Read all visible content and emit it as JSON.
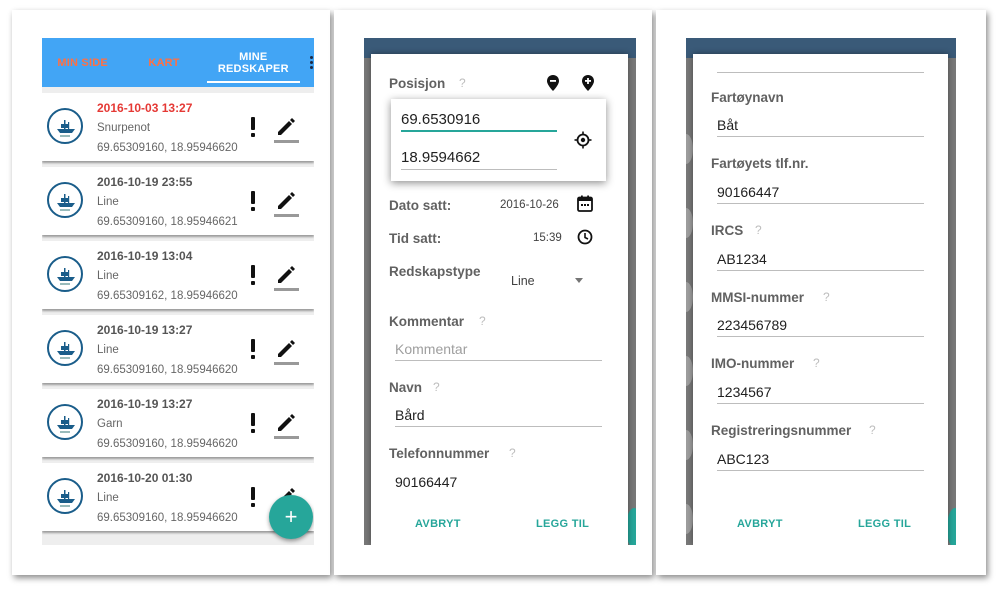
{
  "screen1": {
    "tabs": [
      {
        "label": "MIN SIDE"
      },
      {
        "label": "KART"
      },
      {
        "label": "MINE REDSKAPER"
      }
    ],
    "items": [
      {
        "date": "2016-10-03 13:27",
        "type": "Snurpenot",
        "position": "69.65309160, 18.95946620"
      },
      {
        "date": "2016-10-19 23:55",
        "type": "Line",
        "position": "69.65309160, 18.95946621"
      },
      {
        "date": "2016-10-19 13:04",
        "type": "Line",
        "position": "69.65309162, 18.95946620"
      },
      {
        "date": "2016-10-19 13:27",
        "type": "Line",
        "position": "69.65309160, 18.95946620"
      },
      {
        "date": "2016-10-19 13:27",
        "type": "Garn",
        "position": "69.65309160, 18.95946620"
      },
      {
        "date": "2016-10-20 01:30",
        "type": "Line",
        "position": "69.65309160, 18.95946620"
      }
    ],
    "fab_label": "+",
    "colors": {
      "appbar": "#42a5f5",
      "inactive_tab": "#ff7043",
      "expired_date": "#e53935",
      "fab": "#26a69a"
    }
  },
  "screen2": {
    "position_label": "Posisjon",
    "latitude": "69.6530916",
    "longitude": "18.9594662",
    "date_label": "Dato satt:",
    "date_value": "2016-10-26",
    "time_label": "Tid satt:",
    "time_value": "15:39",
    "gear_type_label": "Redskapstype",
    "gear_type_value": "Line",
    "comment_label": "Kommentar",
    "comment_placeholder": "Kommentar",
    "name_label": "Navn",
    "name_value": "Bård",
    "phone_label": "Telefonnummer",
    "phone_value": "90166447",
    "cancel_label": "AVBRYT",
    "add_label": "LEGG TIL",
    "help": "?"
  },
  "screen3": {
    "vessel_name_label": "Fartøynavn",
    "vessel_name_value": "Båt",
    "vessel_phone_label": "Fartøyets tlf.nr.",
    "vessel_phone_value": "90166447",
    "ircs_label": "IRCS",
    "ircs_value": "AB1234",
    "mmsi_label": "MMSI-nummer",
    "mmsi_value": "223456789",
    "imo_label": "IMO-nummer",
    "imo_value": "1234567",
    "reg_label": "Registreringsnummer",
    "reg_value": "ABC123",
    "cancel_label": "AVBRYT",
    "add_label": "LEGG TIL",
    "help": "?"
  }
}
